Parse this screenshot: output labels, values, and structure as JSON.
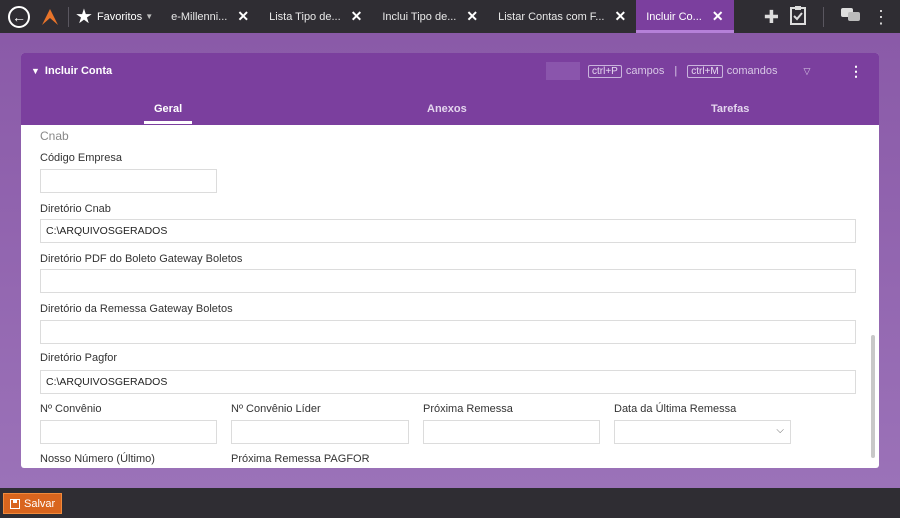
{
  "topbar": {
    "favorites": "Favoritos",
    "tabs": [
      {
        "label": "e-Millenni..."
      },
      {
        "label": "Lista Tipo de..."
      },
      {
        "label": "Inclui Tipo de..."
      },
      {
        "label": "Listar Contas com F..."
      },
      {
        "label": "Incluir Co..."
      }
    ],
    "close_glyph": "✕"
  },
  "panel": {
    "title": "Incluir Conta",
    "shortcut_fields_key": "ctrl+P",
    "shortcut_fields_label": "campos",
    "shortcut_commands_key": "ctrl+M",
    "shortcut_commands_label": "comandos",
    "pipe": "|",
    "tabs": [
      "Geral",
      "Anexos",
      "Tarefas"
    ]
  },
  "form": {
    "section": "Cnab",
    "codigo_empresa": {
      "label": "Código Empresa",
      "value": ""
    },
    "diretorio_cnab": {
      "label": "Diretório Cnab",
      "value": "C:\\ARQUIVOSGERADOS"
    },
    "diretorio_pdf": {
      "label": "Diretório PDF do Boleto Gateway Boletos",
      "value": ""
    },
    "diretorio_remessa": {
      "label": "Diretório da Remessa Gateway Boletos",
      "value": ""
    },
    "diretorio_pagfor": {
      "label": "Diretório Pagfor",
      "value": "C:\\ARQUIVOSGERADOS"
    },
    "num_convenio": {
      "label": "Nº Convênio",
      "value": ""
    },
    "num_convenio_lider": {
      "label": "Nº Convênio Líder",
      "value": ""
    },
    "proxima_remessa": {
      "label": "Próxima Remessa",
      "value": ""
    },
    "data_ultima_remessa": {
      "label": "Data da Última Remessa",
      "value": ""
    },
    "nosso_numero": {
      "label": "Nosso Número (Último)"
    },
    "proxima_remessa_pagfor": {
      "label": "Próxima Remessa PAGFOR"
    }
  },
  "footer": {
    "save_label": "Salvar"
  },
  "colors": {
    "accent": "#7b3f9e",
    "save": "#d9651e",
    "bar": "#2f2d33"
  }
}
